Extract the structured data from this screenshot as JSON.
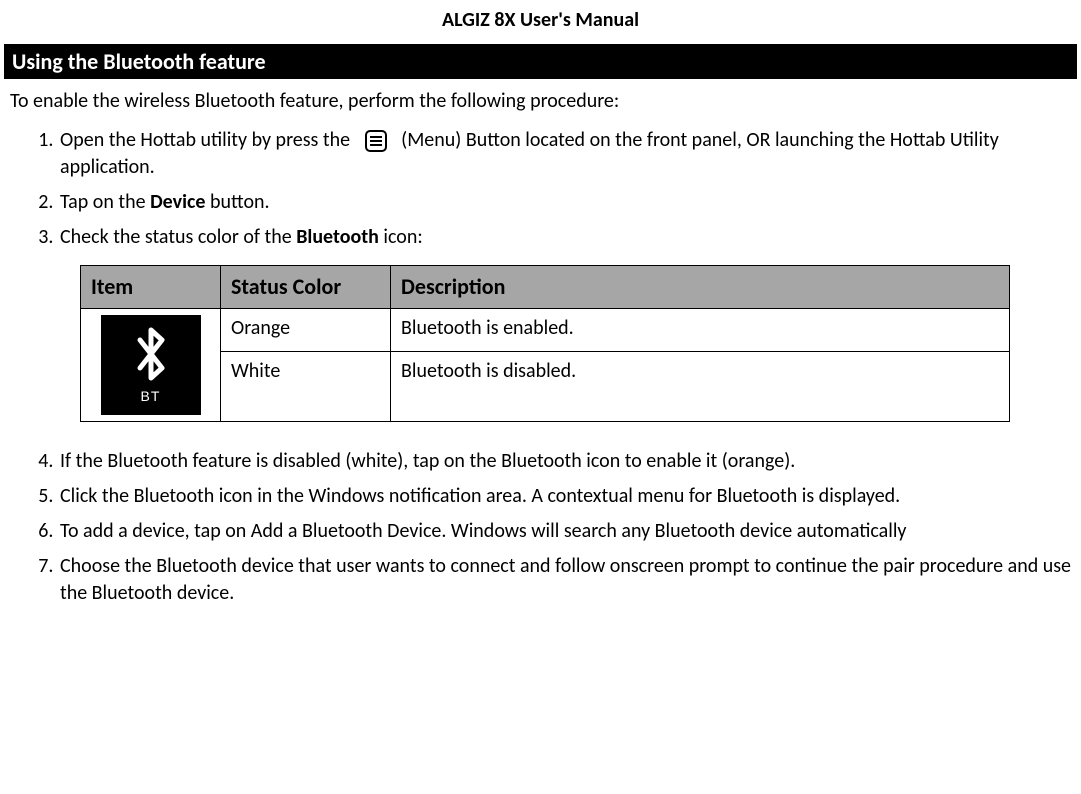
{
  "header": {
    "manual_title": "ALGIZ 8X User's Manual",
    "section_title": "Using the Bluetooth feature"
  },
  "intro": "To enable the wireless Bluetooth feature, perform the following procedure:",
  "steps": {
    "s1a": "Open the Hottab utility by press the",
    "s1b": "(Menu) Button located on the front panel, OR launching the Hottab Utility application.",
    "s2a": "Tap on the ",
    "s2b": "Device",
    "s2c": " button.",
    "s3a": "Check the status color of the ",
    "s3b": "Bluetooth",
    "s3c": " icon:",
    "s4": "If the Bluetooth feature is disabled (white), tap on the Bluetooth icon to enable it (orange).",
    "s5": "Click the Bluetooth icon in the Windows notification area. A contextual menu for Bluetooth is displayed.",
    "s6": "To add a device, tap on Add a Bluetooth Device. Windows will search any Bluetooth device automatically",
    "s7": "Choose the Bluetooth device that user wants to connect and follow onscreen prompt to continue the pair procedure and use the Bluetooth device."
  },
  "table": {
    "headers": {
      "item": "Item",
      "status": "Status Color",
      "desc": "Description"
    },
    "rows": [
      {
        "status": "Orange",
        "desc": "Bluetooth is enabled."
      },
      {
        "status": "White",
        "desc": "Bluetooth is disabled."
      }
    ],
    "icon_label": "BT"
  }
}
